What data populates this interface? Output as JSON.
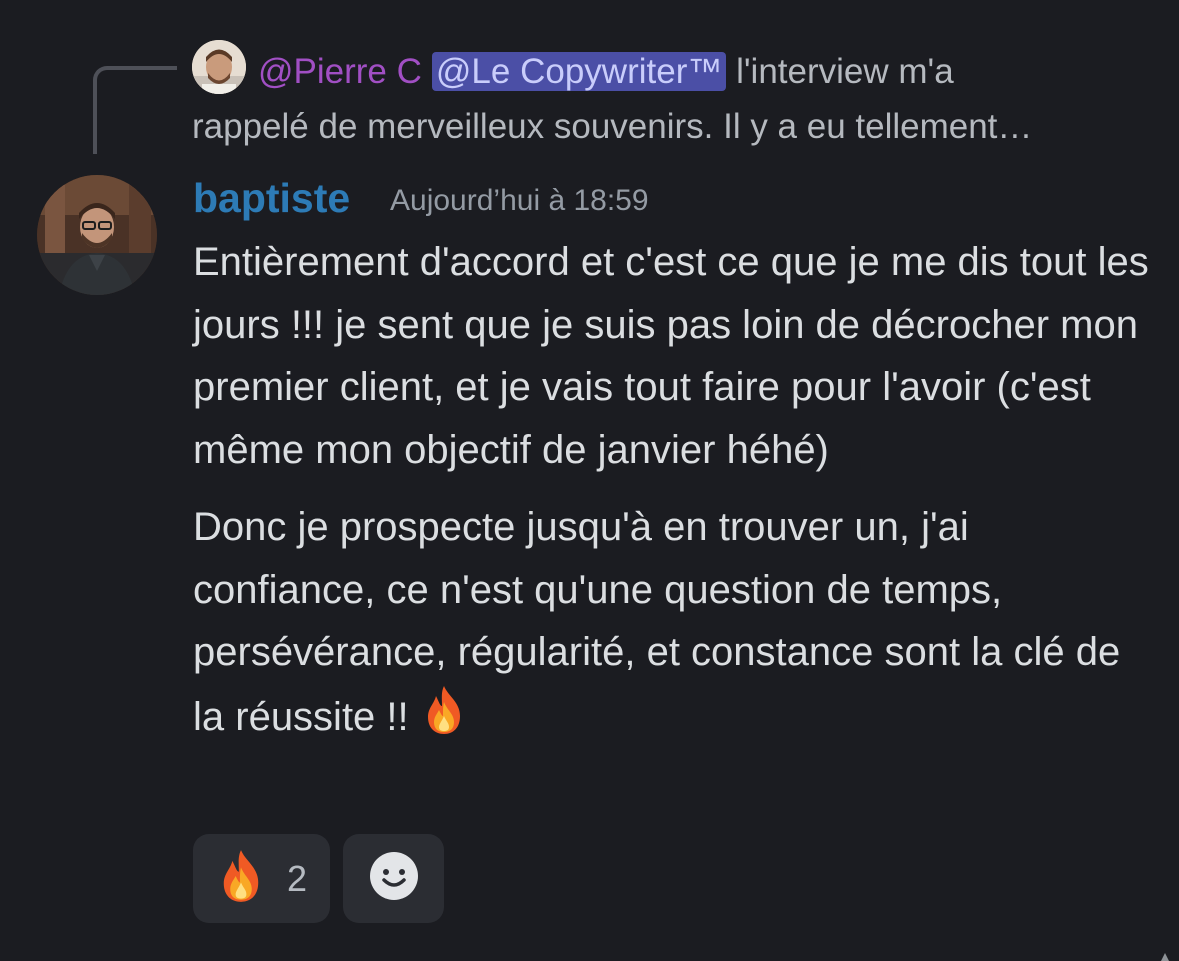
{
  "reply": {
    "author": "@Pierre C",
    "mention": "@Le Copywriter™",
    "text_line1": " l'interview m'a",
    "text_line2": "rappelé de merveilleux souvenirs. Il y a eu tellement…"
  },
  "message": {
    "author": "baptiste",
    "timestamp": "Aujourd’hui à 18:59",
    "paragraph1": "Entièrement d'accord et c'est ce que je me dis tout les jours !!! je sent que je suis pas loin de décrocher mon premier client, et je vais tout faire pour l'avoir (c'est même mon objectif de janvier héhé)",
    "paragraph2": "Donc je prospecte jusqu'à en trouver un, j'ai confiance, ce n'est qu'une question de temps, persévérance, régularité, et constance sont la clé de la réussite !!",
    "paragraph2_emoji": "fire-emoji"
  },
  "reactions": [
    {
      "emoji": "fire-emoji",
      "count": "2"
    },
    {
      "emoji": "add-reaction-icon"
    }
  ],
  "colors": {
    "background": "#1b1c21",
    "author": "#2d7bb6",
    "reply_author": "#a14fc4",
    "mention_bg": "#4b4fa6",
    "reaction_bg": "#2b2d33"
  }
}
